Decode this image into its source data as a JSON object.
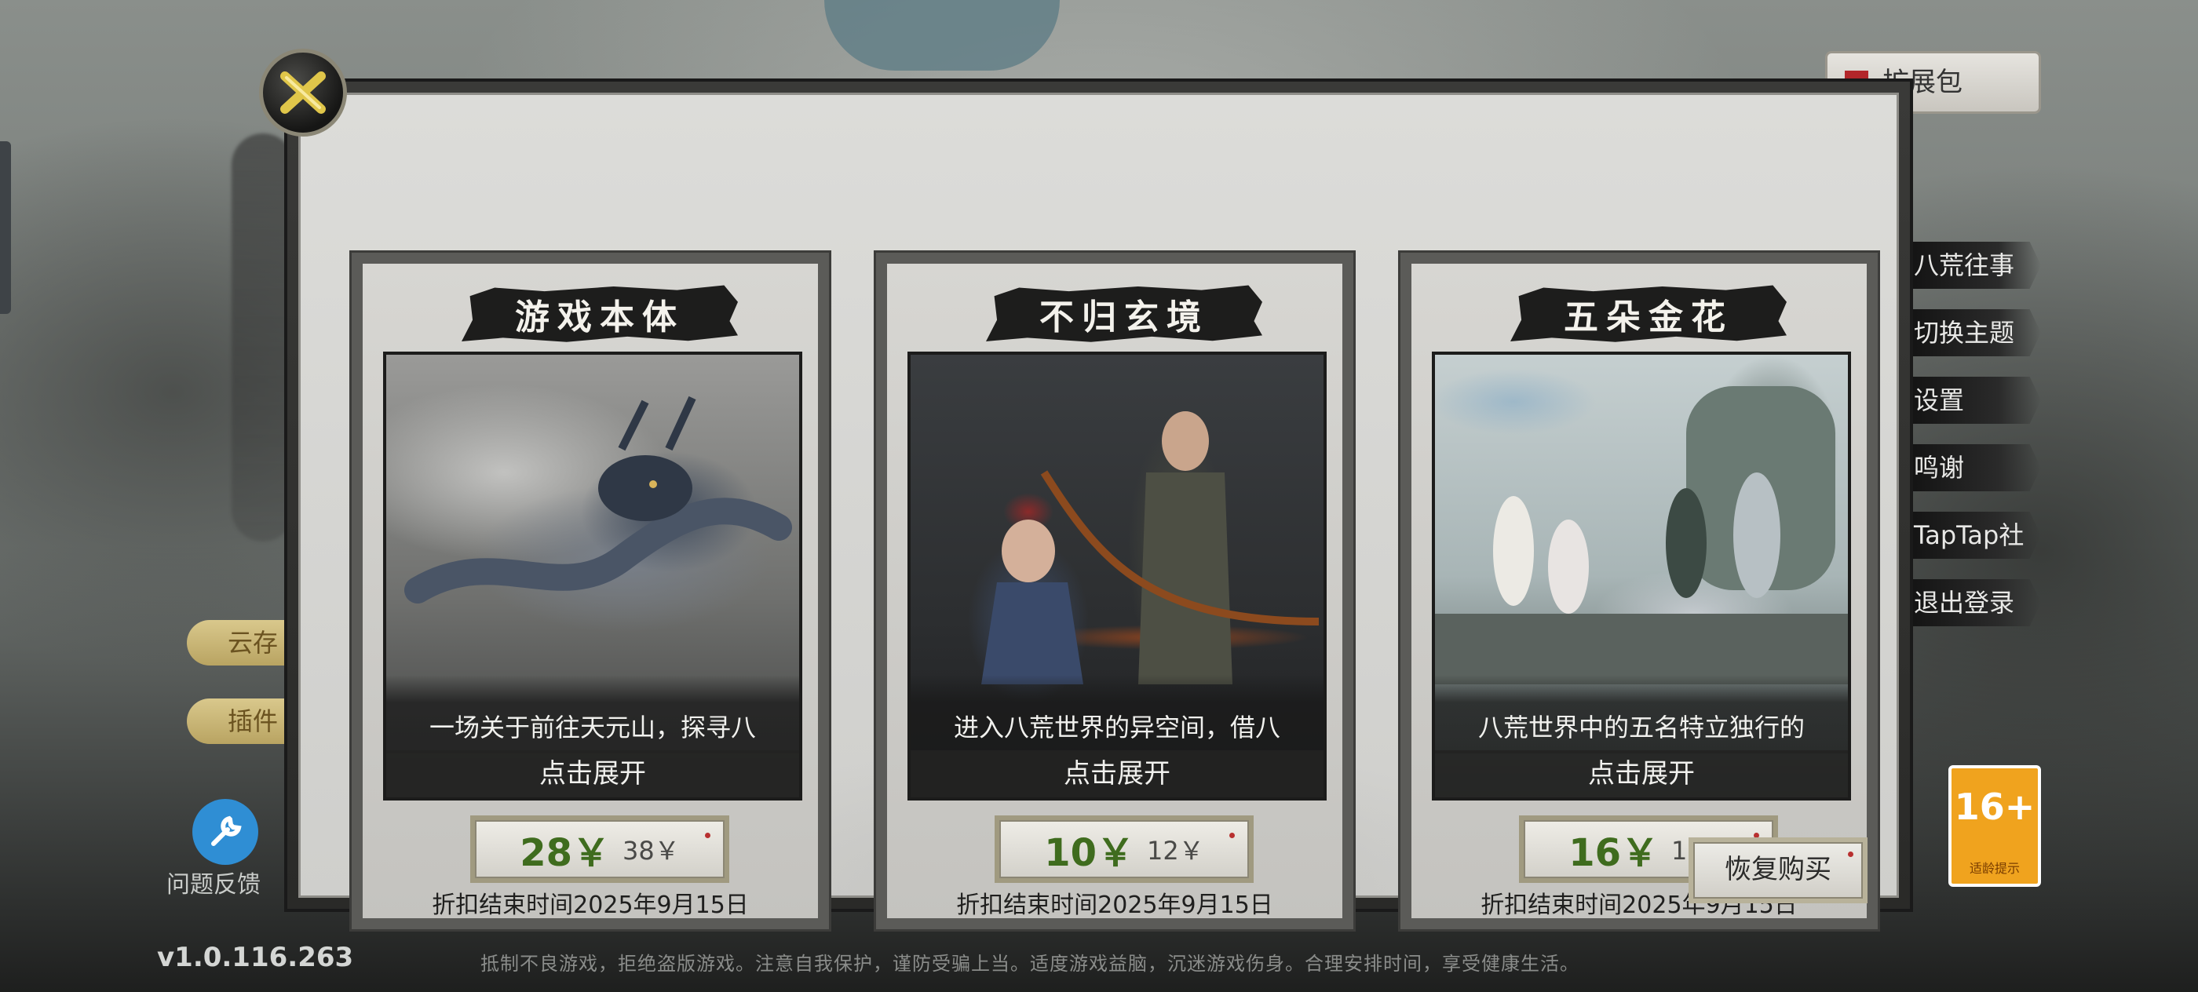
{
  "background": {
    "version": "v1.0.116.263",
    "health_notice": "抵制不良游戏，拒绝盗版游戏。注意自我保护，谨防受骗上当。适度游戏益脑，沉迷游戏伤身。合理安排时间，享受健康生活。",
    "left_menu": [
      "云存",
      "插件"
    ],
    "help_label": "问题反馈",
    "dlc_pill": "扩展包",
    "right_menu": [
      "八荒往事",
      "切换主题",
      "设置",
      "鸣谢",
      "TapTap社区",
      "退出登录"
    ],
    "age_rating": {
      "number": "16+",
      "sub": "适龄提示"
    }
  },
  "dialog": {
    "cards": [
      {
        "title": "游戏本体",
        "description": "一场关于前往天元山，探寻八",
        "expand_label": "点击展开",
        "price_now": "28￥",
        "price_original": "38￥",
        "discount_end": "折扣结束时间2025年9月15日"
      },
      {
        "title": "不归玄境",
        "description": "进入八荒世界的异空间，借八",
        "expand_label": "点击展开",
        "price_now": "10￥",
        "price_original": "12￥",
        "discount_end": "折扣结束时间2025年9月15日"
      },
      {
        "title": "五朵金花",
        "description": "八荒世界中的五名特立独行的",
        "expand_label": "点击展开",
        "price_now": "16￥",
        "price_original": "18￥",
        "discount_end": "折扣结束时间2025年9月15日"
      }
    ],
    "restore_label": "恢复购买",
    "close_icon": "close-x-icon"
  },
  "colors": {
    "price_green": "#3f6c1e",
    "banner_ink": "#1d1d1c",
    "age_badge": "#f0a31e",
    "help_blue": "#2f8ed4"
  }
}
